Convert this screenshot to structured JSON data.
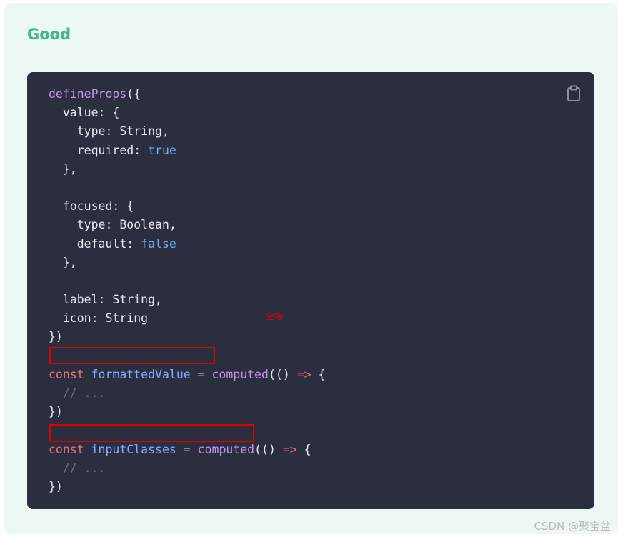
{
  "section_title": "Good",
  "copy_button_icon": "clipboard-icon",
  "code_lines": [
    [
      [
        "func",
        "defineProps"
      ],
      [
        "plain",
        "({"
      ]
    ],
    [
      [
        "plain",
        "  value: {"
      ]
    ],
    [
      [
        "plain",
        "    type: String,"
      ]
    ],
    [
      [
        "plain",
        "    required: "
      ],
      [
        "bool",
        "true"
      ]
    ],
    [
      [
        "plain",
        "  },"
      ]
    ],
    [],
    [
      [
        "plain",
        "  focused: {"
      ]
    ],
    [
      [
        "plain",
        "    type: Boolean,"
      ]
    ],
    [
      [
        "plain",
        "    default: "
      ],
      [
        "bool",
        "false"
      ]
    ],
    [
      [
        "plain",
        "  },"
      ]
    ],
    [],
    [
      [
        "plain",
        "  label: String,"
      ]
    ],
    [
      [
        "plain",
        "  icon: String"
      ]
    ],
    [
      [
        "plain",
        "})"
      ]
    ],
    [],
    [
      [
        "kw",
        "const "
      ],
      [
        "var",
        "formattedValue"
      ],
      [
        "plain",
        " = "
      ],
      [
        "func",
        "computed"
      ],
      [
        "plain",
        "(() "
      ],
      [
        "op",
        "=>"
      ],
      [
        "plain",
        " {"
      ]
    ],
    [
      [
        "comment",
        "  // ..."
      ]
    ],
    [
      [
        "plain",
        "})"
      ]
    ],
    [],
    [
      [
        "kw",
        "const "
      ],
      [
        "var",
        "inputClasses"
      ],
      [
        "plain",
        " = "
      ],
      [
        "func",
        "computed"
      ],
      [
        "plain",
        "(() "
      ],
      [
        "op",
        "=>"
      ],
      [
        "plain",
        " {"
      ]
    ],
    [
      [
        "comment",
        "  // ..."
      ]
    ],
    [
      [
        "plain",
        "})"
      ]
    ]
  ],
  "annotation_text": "空格",
  "watermark": "CSDN @聚宝盆"
}
